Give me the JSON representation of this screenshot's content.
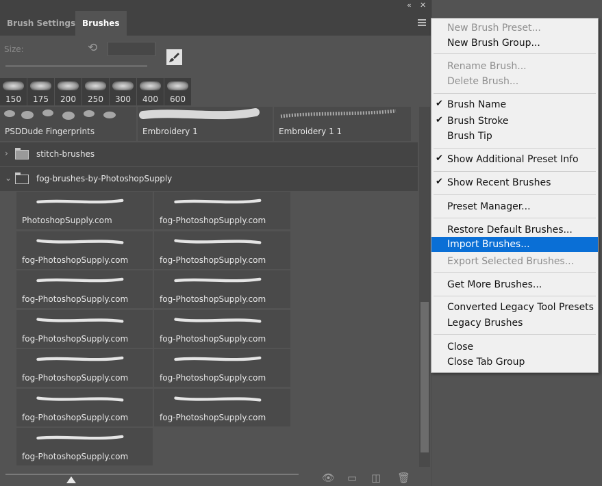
{
  "tabs": [
    {
      "label": "Brush Settings",
      "active": false
    },
    {
      "label": "Brushes",
      "active": true
    }
  ],
  "window_controls": {
    "collapse": "«",
    "close": "✕"
  },
  "size": {
    "label": "Size:",
    "value": ""
  },
  "recent_brush_sizes": [
    "150",
    "175",
    "200",
    "250",
    "300",
    "400",
    "600"
  ],
  "top_brushes": [
    "PSDDude Fingerprints",
    "Embroidery 1",
    "Embroidery 1 1"
  ],
  "groups": [
    {
      "name": "stitch-brushes",
      "expanded": false
    },
    {
      "name": "fog-brushes-by-PhotoshopSupply",
      "expanded": true
    }
  ],
  "fog_brushes": [
    "PhotoshopSupply.com",
    "fog-PhotoshopSupply.com",
    "fog-PhotoshopSupply.com",
    "fog-PhotoshopSupply.com",
    "fog-PhotoshopSupply.com",
    "fog-PhotoshopSupply.com",
    "fog-PhotoshopSupply.com",
    "fog-PhotoshopSupply.com",
    "fog-PhotoshopSupply.com",
    "fog-PhotoshopSupply.com",
    "fog-PhotoshopSupply.com",
    "fog-PhotoshopSupply.com",
    "fog-PhotoshopSupply.com"
  ],
  "menu": {
    "items": [
      {
        "label": "New Brush Preset...",
        "disabled": true
      },
      {
        "label": "New Brush Group..."
      },
      {
        "label": "Rename Brush...",
        "disabled": true
      },
      {
        "label": "Delete Brush...",
        "disabled": true
      },
      {
        "label": "Brush Name",
        "checked": true
      },
      {
        "label": "Brush Stroke",
        "checked": true
      },
      {
        "label": "Brush Tip"
      },
      {
        "label": "Show Additional Preset Info",
        "checked": true
      },
      {
        "label": "Show Recent Brushes",
        "checked": true
      },
      {
        "label": "Preset Manager..."
      },
      {
        "label": "Restore Default Brushes..."
      },
      {
        "label": "Import Brushes...",
        "highlighted": true
      },
      {
        "label": "Export Selected Brushes...",
        "disabled": true
      },
      {
        "label": "Get More Brushes..."
      },
      {
        "label": "Converted Legacy Tool Presets"
      },
      {
        "label": "Legacy Brushes"
      },
      {
        "label": "Close"
      },
      {
        "label": "Close Tab Group"
      }
    ]
  },
  "colors": {
    "panel": "#535353",
    "highlight": "#0a6fd6",
    "menu_bg": "#f0f0f0"
  }
}
